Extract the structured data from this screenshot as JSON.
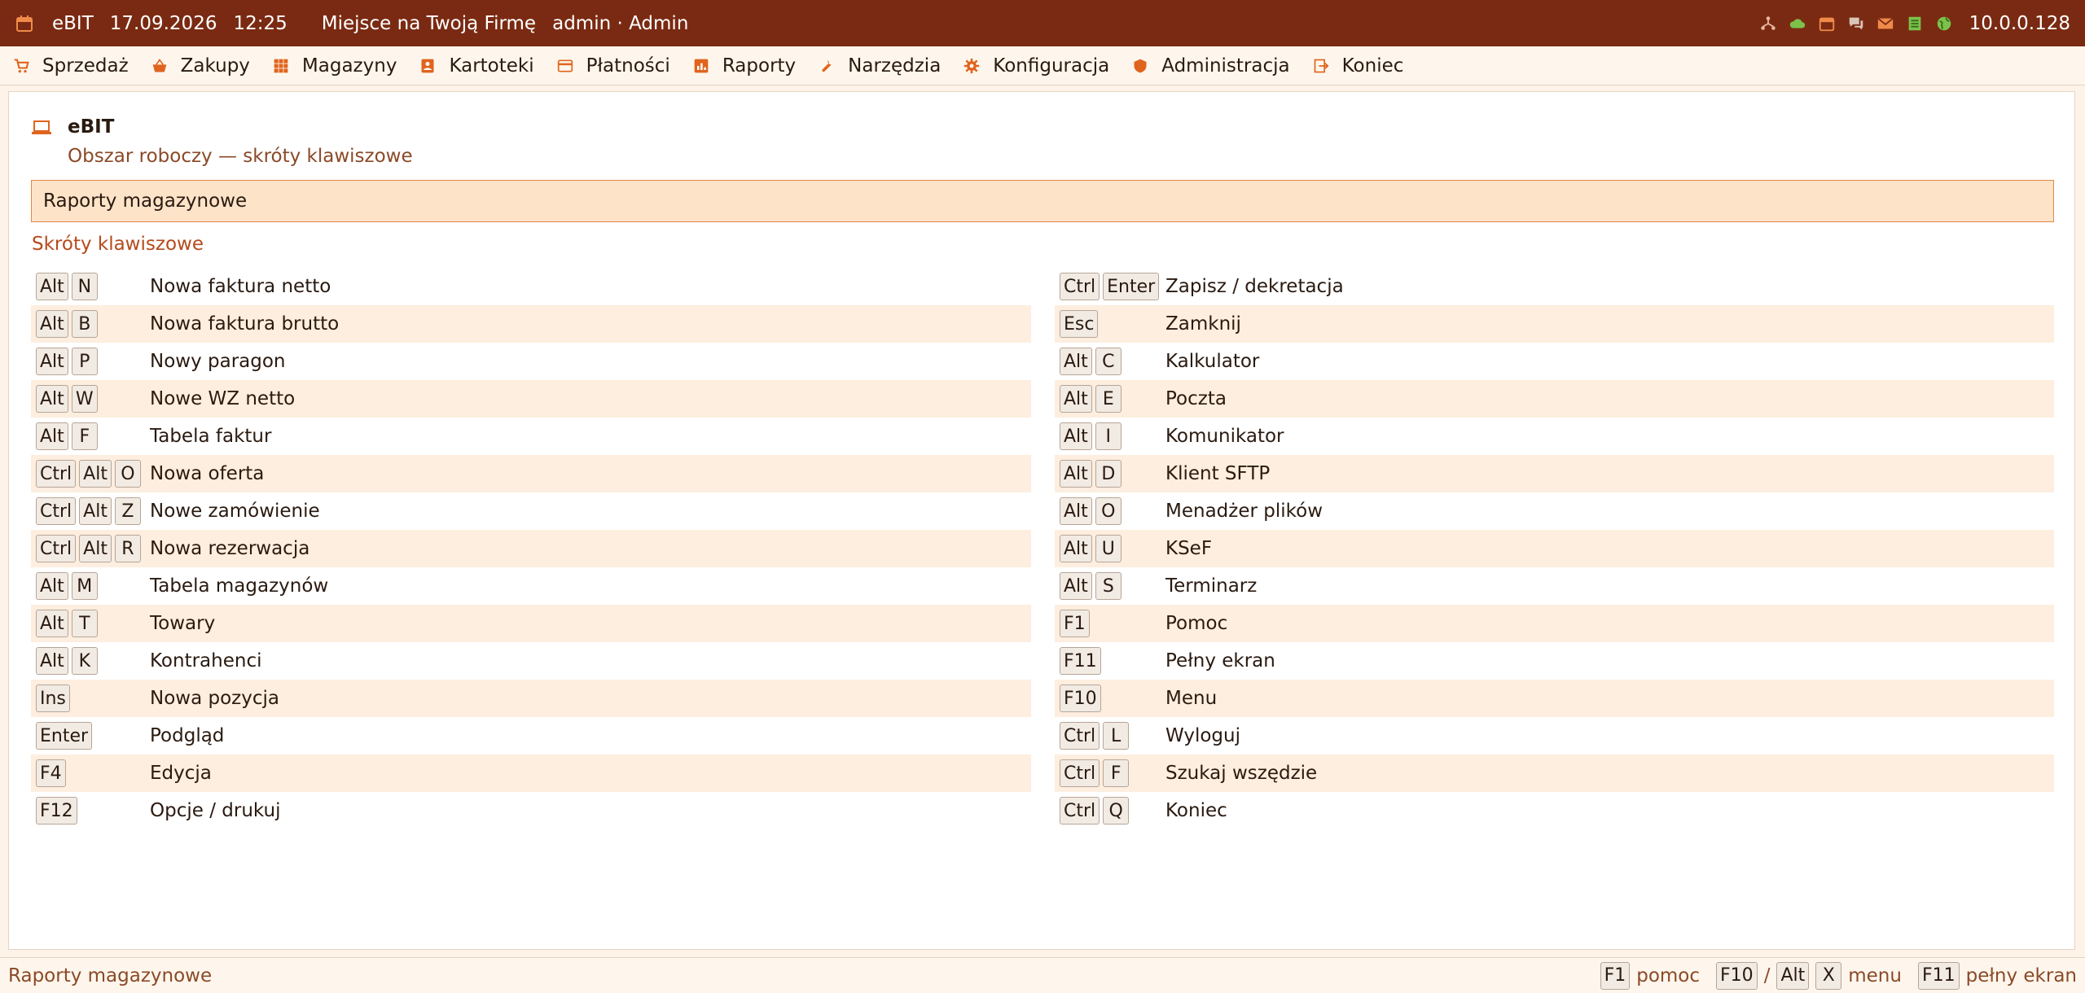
{
  "titlebar": {
    "app": "eBIT",
    "date": "17.09.2026",
    "time": "12:25",
    "company": "Miejsce na Twoją Firmę",
    "user": "admin · Admin",
    "ip": "10.0.0.128",
    "tray_icons": [
      "network-icon",
      "cloud-icon",
      "calendar-icon",
      "chat-icon",
      "mail-icon",
      "notes-icon",
      "globe-icon"
    ]
  },
  "menu": [
    {
      "label": "Sprzedaż",
      "icon": "cart-icon"
    },
    {
      "label": "Zakupy",
      "icon": "basket-icon"
    },
    {
      "label": "Magazyny",
      "icon": "grid-icon"
    },
    {
      "label": "Kartoteki",
      "icon": "contact-icon"
    },
    {
      "label": "Płatności",
      "icon": "card-icon"
    },
    {
      "label": "Raporty",
      "icon": "report-icon"
    },
    {
      "label": "Narzędzia",
      "icon": "wrench-icon"
    },
    {
      "label": "Konfiguracja",
      "icon": "gear-icon"
    },
    {
      "label": "Administracja",
      "icon": "shield-icon"
    },
    {
      "label": "Koniec",
      "icon": "exit-icon"
    }
  ],
  "workspace": {
    "title": "eBIT",
    "subtitle": "Obszar roboczy — skróty klawiszowe",
    "section": "Raporty magazynowe",
    "shortcuts_title": "Skróty klawiszowe"
  },
  "shortcuts_left": [
    {
      "keys": [
        "Alt",
        "N"
      ],
      "action": "Nowa faktura netto"
    },
    {
      "keys": [
        "Alt",
        "B"
      ],
      "action": "Nowa faktura brutto"
    },
    {
      "keys": [
        "Alt",
        "P"
      ],
      "action": "Nowy paragon"
    },
    {
      "keys": [
        "Alt",
        "W"
      ],
      "action": "Nowe WZ netto"
    },
    {
      "keys": [
        "Alt",
        "F"
      ],
      "action": "Tabela faktur"
    },
    {
      "keys": [
        "Ctrl",
        "Alt",
        "O"
      ],
      "action": "Nowa oferta"
    },
    {
      "keys": [
        "Ctrl",
        "Alt",
        "Z"
      ],
      "action": "Nowe zamówienie"
    },
    {
      "keys": [
        "Ctrl",
        "Alt",
        "R"
      ],
      "action": "Nowa rezerwacja"
    },
    {
      "keys": [
        "Alt",
        "M"
      ],
      "action": "Tabela magazynów"
    },
    {
      "keys": [
        "Alt",
        "T"
      ],
      "action": "Towary"
    },
    {
      "keys": [
        "Alt",
        "K"
      ],
      "action": "Kontrahenci"
    },
    {
      "keys": [
        "Ins"
      ],
      "action": "Nowa pozycja"
    },
    {
      "keys": [
        "Enter"
      ],
      "action": "Podgląd"
    },
    {
      "keys": [
        "F4"
      ],
      "action": "Edycja"
    },
    {
      "keys": [
        "F12"
      ],
      "action": "Opcje / drukuj"
    }
  ],
  "shortcuts_right": [
    {
      "keys": [
        "Ctrl",
        "Enter"
      ],
      "action": "Zapisz / dekretacja"
    },
    {
      "keys": [
        "Esc"
      ],
      "action": "Zamknij"
    },
    {
      "keys": [
        "Alt",
        "C"
      ],
      "action": "Kalkulator"
    },
    {
      "keys": [
        "Alt",
        "E"
      ],
      "action": "Poczta"
    },
    {
      "keys": [
        "Alt",
        "I"
      ],
      "action": "Komunikator"
    },
    {
      "keys": [
        "Alt",
        "D"
      ],
      "action": "Klient SFTP"
    },
    {
      "keys": [
        "Alt",
        "O"
      ],
      "action": "Menadżer plików"
    },
    {
      "keys": [
        "Alt",
        "U"
      ],
      "action": "KSeF"
    },
    {
      "keys": [
        "Alt",
        "S"
      ],
      "action": "Terminarz"
    },
    {
      "keys": [
        "F1"
      ],
      "action": "Pomoc"
    },
    {
      "keys": [
        "F11"
      ],
      "action": "Pełny ekran"
    },
    {
      "keys": [
        "F10"
      ],
      "action": "Menu"
    },
    {
      "keys": [
        "Ctrl",
        "L"
      ],
      "action": "Wyloguj"
    },
    {
      "keys": [
        "Ctrl",
        "F"
      ],
      "action": "Szukaj wszędzie"
    },
    {
      "keys": [
        "Ctrl",
        "Q"
      ],
      "action": "Koniec"
    }
  ],
  "statusbar": {
    "context": "Raporty magazynowe",
    "help_key": "F1",
    "help_label": "pomoc",
    "menu_key1": "F10",
    "menu_sep": "/",
    "menu_key2": "Alt",
    "menu_key3": "X",
    "menu_label": "menu",
    "fullscreen_key": "F11",
    "fullscreen_label": "pełny ekran"
  },
  "colors": {
    "titlebar": "#7a2a12",
    "accent": "#e0641e",
    "section_bg": "#fde3c8",
    "row_alt": "#fdeedf"
  }
}
